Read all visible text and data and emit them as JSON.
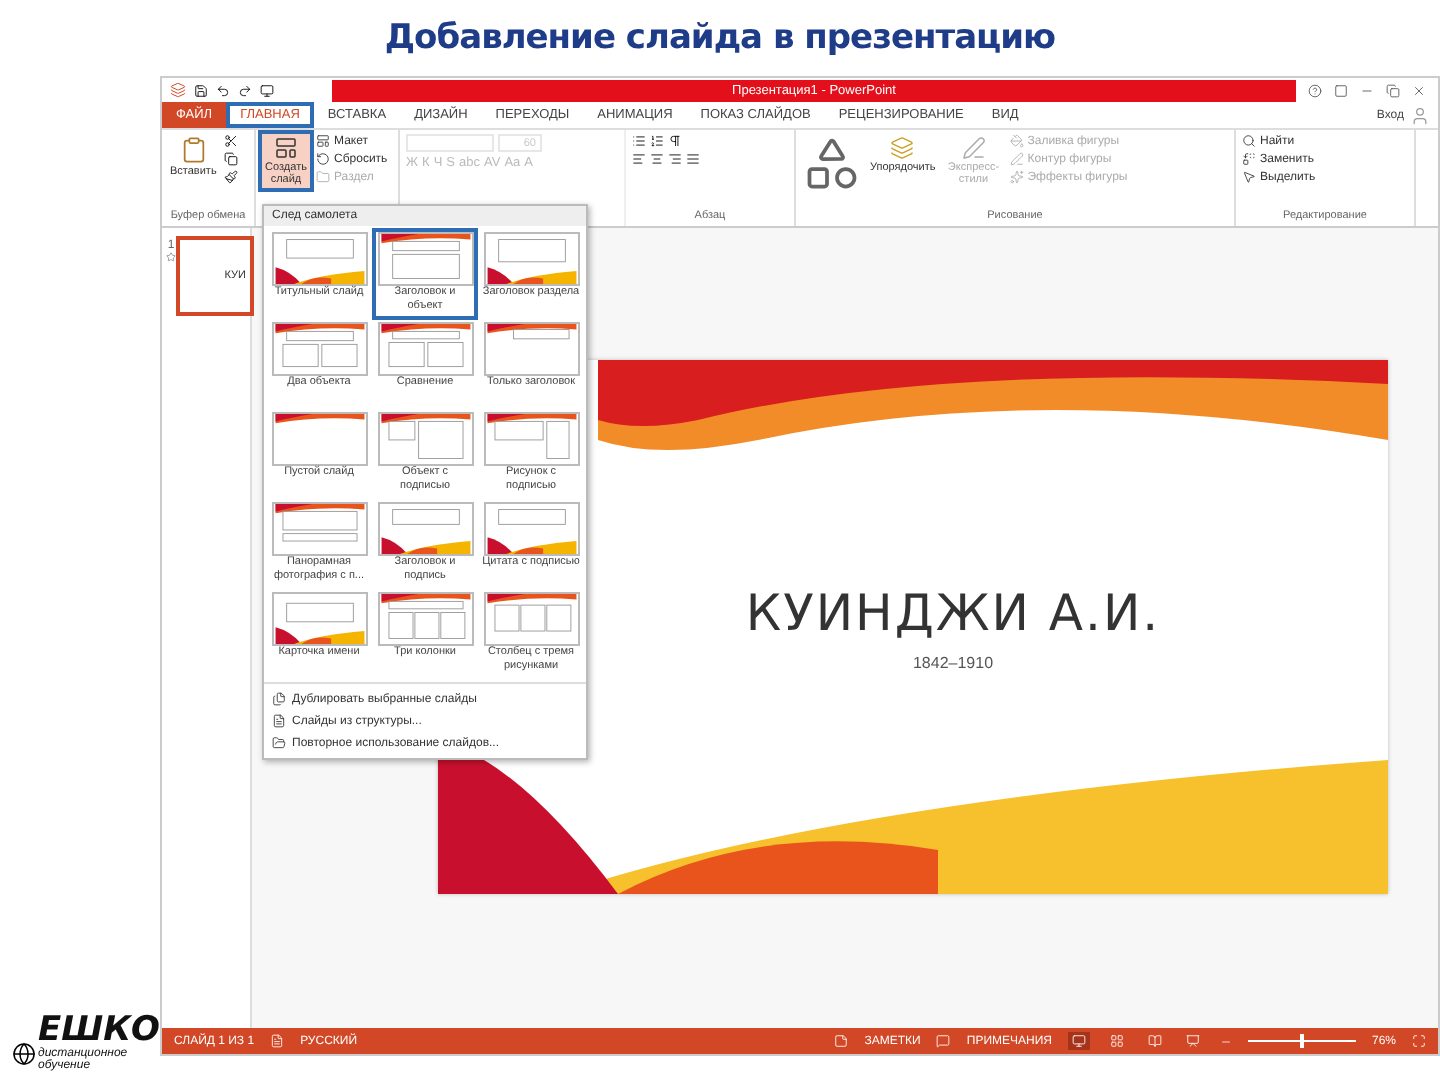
{
  "heading": "Добавление слайда в презентацию",
  "logo": {
    "name": "ЕШКО",
    "tagline": "дистанционное обучение"
  },
  "window": {
    "title": "Презентация1 - PowerPoint",
    "account": "Вход"
  },
  "tabs": [
    {
      "label": "ФАЙЛ",
      "kind": "file",
      "selected": false
    },
    {
      "label": "ГЛАВНАЯ",
      "kind": "tab",
      "selected": true
    },
    {
      "label": "ВСТАВКА",
      "kind": "tab",
      "selected": false
    },
    {
      "label": "ДИЗАЙН",
      "kind": "tab",
      "selected": false
    },
    {
      "label": "ПЕРЕХОДЫ",
      "kind": "tab",
      "selected": false
    },
    {
      "label": "АНИМАЦИЯ",
      "kind": "tab",
      "selected": false
    },
    {
      "label": "ПОКАЗ СЛАЙДОВ",
      "kind": "tab",
      "selected": false
    },
    {
      "label": "РЕЦЕНЗИРОВАНИЕ",
      "kind": "tab",
      "selected": false
    },
    {
      "label": "ВИД",
      "kind": "tab",
      "selected": false
    }
  ],
  "clipboard": {
    "paste": "Вставить",
    "label": "Буфер обмена"
  },
  "slides_group": {
    "new_slide": "Создать слайд",
    "open": true,
    "items": [
      {
        "label": "Макет",
        "disabled": false
      },
      {
        "label": "Сбросить",
        "disabled": false
      },
      {
        "label": "Раздел",
        "disabled": true
      }
    ]
  },
  "font": {
    "size": "60",
    "buttons": [
      "Ж",
      "К",
      "Ч",
      "S",
      "abc",
      "AV",
      "Aa",
      "A"
    ],
    "disabled": true
  },
  "paragraph": {
    "label": "Абзац"
  },
  "drawing": {
    "arrange": "Упорядочить",
    "quick_styles": "Экспресс-стили",
    "items": [
      {
        "label": "Заливка фигуры",
        "disabled": true
      },
      {
        "label": "Контур фигуры",
        "disabled": true
      },
      {
        "label": "Эффекты фигуры",
        "disabled": true
      }
    ],
    "label": "Рисование"
  },
  "editing": {
    "items": [
      "Найти",
      "Заменить",
      "Выделить"
    ],
    "label": "Редактирование"
  },
  "thumbnails": [
    {
      "number": "1",
      "text": "КУИ",
      "selected": true
    }
  ],
  "layout_gallery": {
    "theme": "След самолета",
    "layouts": [
      {
        "label": "Титульный слайд",
        "kind": "title",
        "selected": false
      },
      {
        "label": "Заголовок и объект",
        "kind": "content",
        "selected": true
      },
      {
        "label": "Заголовок раздела",
        "kind": "section",
        "selected": false
      },
      {
        "label": "Два объекта",
        "kind": "two",
        "selected": false
      },
      {
        "label": "Сравнение",
        "kind": "compare",
        "selected": false
      },
      {
        "label": "Только заголовок",
        "kind": "title_only",
        "selected": false
      },
      {
        "label": "Пустой слайд",
        "kind": "blank",
        "selected": false
      },
      {
        "label": "Объект с подписью",
        "kind": "caption_content",
        "selected": false
      },
      {
        "label": "Рисунок с подписью",
        "kind": "caption_picture",
        "selected": false
      },
      {
        "label": "Панорамная фотография с п...",
        "kind": "panorama",
        "selected": false
      },
      {
        "label": "Заголовок и подпись",
        "kind": "title_caption",
        "selected": false
      },
      {
        "label": "Цитата с подписью",
        "kind": "quote",
        "selected": false
      },
      {
        "label": "Карточка имени",
        "kind": "name_card",
        "selected": false
      },
      {
        "label": "Три колонки",
        "kind": "three_col",
        "selected": false
      },
      {
        "label": "Столбец с тремя рисунками",
        "kind": "three_pic",
        "selected": false
      }
    ],
    "actions": [
      {
        "label": "Дублировать выбранные слайды",
        "kind": "duplicate"
      },
      {
        "label": "Слайды из структуры...",
        "kind": "outline"
      },
      {
        "label": "Повторное использование слайдов...",
        "kind": "reuse"
      }
    ]
  },
  "slide": {
    "title": "КУИНДЖИ А.И.",
    "subtitle": "1842–1910"
  },
  "status_bar": {
    "slide": "СЛАЙД 1 ИЗ 1",
    "language": "РУССКИЙ",
    "notes": "ЗАМЕТКИ",
    "comments": "ПРИМЕЧАНИЯ",
    "zoom": "76%",
    "views": [
      {
        "kind": "normal",
        "selected": true
      },
      {
        "kind": "sorter",
        "selected": false
      },
      {
        "kind": "reading",
        "selected": false
      },
      {
        "kind": "show",
        "selected": false
      }
    ],
    "zoom_slider": {
      "level": 0.5
    }
  }
}
